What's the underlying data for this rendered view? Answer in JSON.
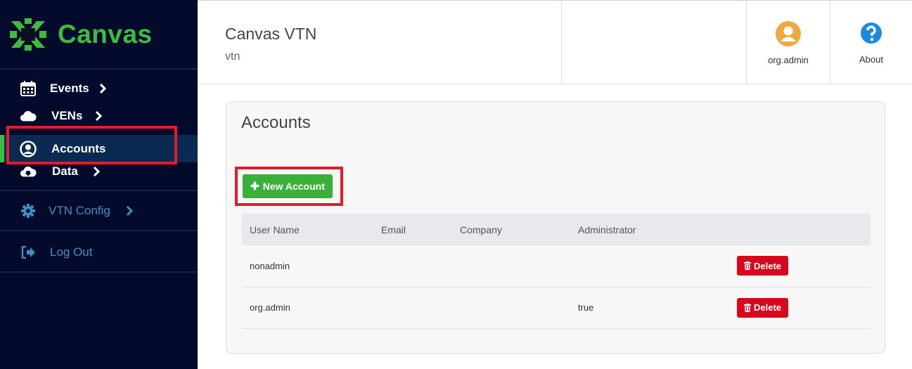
{
  "brand": {
    "name": "Canvas",
    "color": "#3dbd3d"
  },
  "sidebar": {
    "items": [
      {
        "label": "Events",
        "icon": "calendar-icon"
      },
      {
        "label": "VENs",
        "icon": "cloud-icon"
      },
      {
        "label": "Accounts",
        "icon": "user-circle-icon",
        "active": true
      },
      {
        "label": "Data",
        "icon": "cloud-download-icon"
      },
      {
        "label": "VTN Config",
        "icon": "gear-icon"
      },
      {
        "label": "Log Out",
        "icon": "sign-out-icon"
      }
    ]
  },
  "header": {
    "title": "Canvas VTN",
    "subtitle": "vtn",
    "user_label": "org.admin",
    "about_label": "About"
  },
  "main": {
    "title": "Accounts",
    "new_button": "New Account",
    "columns": [
      "User Name",
      "Email",
      "Company",
      "Administrator",
      ""
    ],
    "rows": [
      {
        "username": "nonadmin",
        "email": "",
        "company": "",
        "administrator": "",
        "action": "Delete"
      },
      {
        "username": "org.admin",
        "email": "",
        "company": "",
        "administrator": "true",
        "action": "Delete"
      }
    ]
  },
  "colors": {
    "sidebar_bg": "#030a2b",
    "accent_green": "#3aaf3a",
    "danger": "#d9071d",
    "highlight": "#e31b2b"
  }
}
